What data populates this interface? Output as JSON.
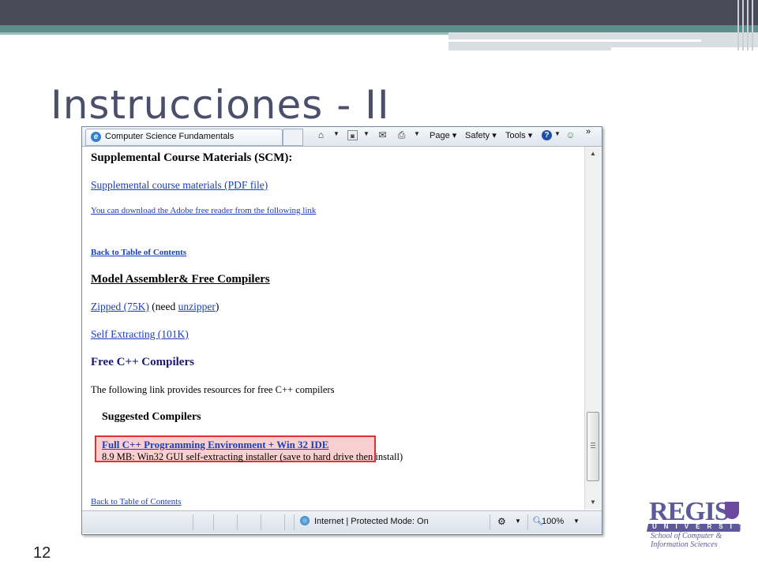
{
  "slide": {
    "title": "Instrucciones - II",
    "number": "12"
  },
  "browser": {
    "tab_title": "Computer Science Fundamentals",
    "toolbar": {
      "page_label": "Page",
      "safety_label": "Safety",
      "tools_label": "Tools",
      "overflow": "»"
    },
    "status": {
      "zone": "Internet | Protected Mode: On",
      "zoom": "100%"
    }
  },
  "page": {
    "scm_heading": "Supplemental Course Materials (SCM):",
    "scm_link": "Supplemental course materials (PDF file)",
    "adobe_link": "You can download the Adobe free reader from the following link",
    "back_link_1": "Back to Table of Contents",
    "assembler_heading": "Model Assembler& Free Compilers",
    "zipped_link": "Zipped (75K)",
    "need_prefix": " (need ",
    "unzipper_link": "unzipper",
    "need_suffix": ")",
    "self_extracting_link": "Self Extracting (101K)",
    "cpp_heading": "Free C++ Compilers",
    "cpp_text": "The following link provides resources for free C++ compilers",
    "suggested_heading": "Suggested Compilers",
    "ide_link": "Full C++ Programming Environment  +  Win 32 IDE",
    "ide_desc": "8.9 MB: Win32 GUI self-extracting installer (save to hard drive then install)",
    "back_link_2": "Back to Table of Contents"
  },
  "logo": {
    "name": "REGIS",
    "university": "UNIVERSITY",
    "line1": "School of Computer &",
    "line2": "Information Sciences"
  },
  "colors": {
    "link": "#1a3fb8",
    "title": "#4b4f6b",
    "highlight_border": "#e23030"
  }
}
